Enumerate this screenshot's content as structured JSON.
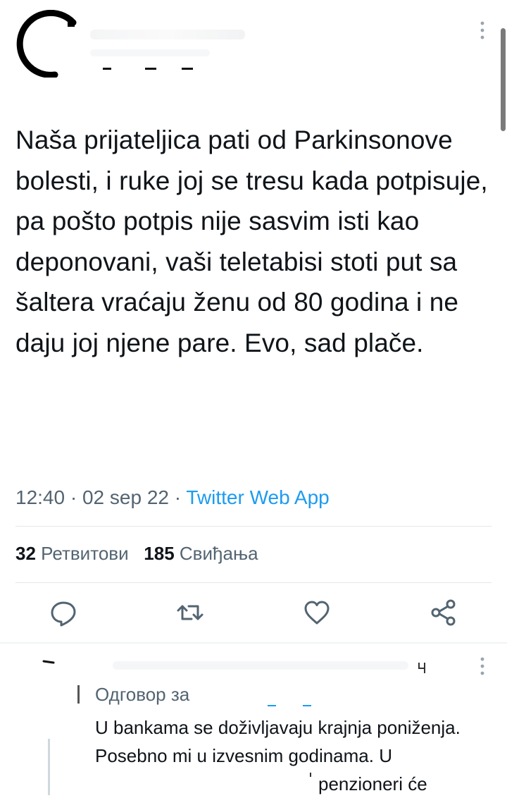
{
  "tweet": {
    "text": "Naša prijateljica pati od Parkinsonove bolesti, i ruke joj se tresu kada potpisuje, pa pošto potpis nije sasvim isti kao deponovani, vaši teletabisi stoti put sa šaltera vraćaju ženu od 80 godina i ne daju joj njene pare. Evo, sad plače.",
    "time": "12:40",
    "separator": " · ",
    "date": "02 sep 22",
    "source": "Twitter Web App"
  },
  "stats": {
    "retweets_count": "32",
    "retweets_label": "Ретвитови",
    "likes_count": "185",
    "likes_label": "Свиђања"
  },
  "reply": {
    "replying_to_label": "Одговор за",
    "text_start": "U bankama se doživljavaju krajnja poniženja. Posebno mi u izvesnim godinama. U",
    "text_end": "penzioneri će"
  },
  "icons": {
    "reply": "reply-icon",
    "retweet": "retweet-icon",
    "like": "like-icon",
    "share": "share-icon",
    "more": "more-vertical-icon"
  },
  "colors": {
    "text": "#0f1419",
    "secondary": "#536471",
    "link": "#1d9bf0"
  }
}
